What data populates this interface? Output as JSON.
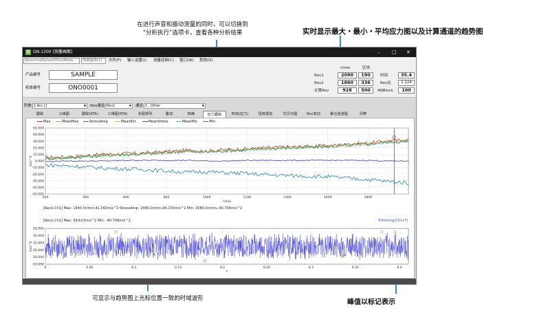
{
  "annotations": {
    "top_center": [
      "在进行声音和振动测量的同时，可以切换到",
      "“分析执行”选项卡，查看各种分析结果"
    ],
    "top_right": "实时显示最大・最小・平均应力图以及计算通道的趋势图",
    "bottom_center": "可显示与趋势图上光标位置一致的时域波形",
    "bottom_right": "峰值以标记表示"
  },
  "window": {
    "title": "GN-1200 [测量画面]",
    "logo": "G",
    "controls": [
      "–",
      "□",
      "✕"
    ]
  },
  "menubar": {
    "doc_tabs": [
      "AbnormalNoiseOfflineMode",
      "导航指导(1)"
    ],
    "items": [
      "文件(F)",
      "输入设置(I)",
      "测量控制(C)",
      "窗口(W)",
      "其他(O)"
    ]
  },
  "info": {
    "product_label": "产品编号",
    "product_value": "SAMPLE",
    "machine_label": "机体编号",
    "machine_value": "ONO0001",
    "unit_rmin": "r/min",
    "section_label": "区块",
    "rev1_label": "Rev1",
    "rev1_value": "2090",
    "rev1_section": "190",
    "rev2_label": "Rev2",
    "rev2_value": "1860",
    "rev2_section": "336",
    "calc_label": "计算Rev",
    "calc_value": "928",
    "calc_section": "500",
    "time_label": "时间",
    "time_value": "35.4",
    "revratio_label": "Rev比",
    "revratio_value": "1.124",
    "anblock_label": "ANBlock",
    "anblock_value": "100"
  },
  "selectors": {
    "stage_label": "阶数",
    "stage_value": "1 Acc.[]",
    "rev_label": "Rev通道",
    "rev_value": "Rev1",
    "channel_label": "通道",
    "channel_value": "1 , Other"
  },
  "tabs": [
    "跟踪",
    "三维图",
    "跟踪(RTA)",
    "三维图(RTA)",
    "多图排列",
    "叠加",
    "四维",
    "应力跟踪",
    "时域(应力)",
    "扭转振动",
    "坎贝尔图",
    "Rev变动",
    "聚合信道程",
    "列表"
  ],
  "active_tab": "应力跟踪",
  "legend": [
    {
      "label": "Max",
      "color": "#d22a2a"
    },
    {
      "label": "MeanMax",
      "color": "#f08a4b"
    },
    {
      "label": "StressAmp",
      "color": "#2b7d2b"
    },
    {
      "label": "MeanExt",
      "color": "#d7c51e"
    },
    {
      "label": "MeanStress",
      "color": "#3a3acf"
    },
    {
      "label": "MeanMin",
      "color": "#3fc0c0"
    },
    {
      "label": "Min",
      "color": "#1a8a9a"
    }
  ],
  "chart_data": [
    {
      "type": "line",
      "ylabel": "m/s^2",
      "xlabel": "r/min",
      "xlim": [
        200,
        2000
      ],
      "ylim": [
        -50,
        50
      ],
      "x_ticks": [
        "200",
        "400",
        "600",
        "800",
        "1000",
        "1200",
        "1400",
        "1600",
        "1800"
      ],
      "y_ticks": [
        "50.000",
        "40.000",
        "30.000",
        "20.000",
        "10.000",
        "0.000",
        "-10.000",
        "-20.000",
        "-30.000",
        "-40.000",
        "-50.000"
      ],
      "x": [
        200,
        300,
        400,
        500,
        600,
        700,
        800,
        900,
        1000,
        1100,
        1200,
        1300,
        1400,
        1500,
        1600,
        1700,
        1800,
        1900,
        2000
      ],
      "series": [
        {
          "name": "Max",
          "values": [
            5,
            6,
            8,
            10,
            11,
            12,
            14,
            16,
            15,
            17,
            18,
            20,
            21,
            22,
            23,
            25,
            27,
            30,
            32
          ]
        },
        {
          "name": "StressAmp",
          "values": [
            4,
            5,
            7,
            9,
            10,
            11,
            13,
            15,
            14,
            16,
            17,
            19,
            20,
            21,
            22,
            24,
            26,
            29,
            30
          ]
        },
        {
          "name": "MeanStress",
          "values": [
            -1,
            0,
            0,
            0,
            1,
            1,
            1,
            1,
            0,
            0,
            1,
            1,
            1,
            1,
            1,
            1,
            1,
            0,
            0
          ]
        },
        {
          "name": "Min",
          "values": [
            -6,
            -7,
            -9,
            -11,
            -12,
            -13,
            -15,
            -17,
            -16,
            -18,
            -19,
            -21,
            -22,
            -23,
            -24,
            -26,
            -28,
            -31,
            -33
          ]
        }
      ],
      "cursor_x": 1930,
      "info_line": "[Rev1-Ch1] Max: 1940.0r/min,41.342m/s^2 StressAmp: 2080.0r/min,40.150m/s^2 Min: 2080.0r/min,-40.706m/s^2"
    },
    {
      "type": "line",
      "ylabel": "m/s^2",
      "xlabel": "s",
      "xlim": [
        0,
        0.41
      ],
      "ylim": [
        -50,
        50
      ],
      "x_ticks": [
        "0",
        "0.05",
        "0.1",
        "0.15",
        "0.2",
        "0.25",
        "0.3",
        "0.35",
        "0.4"
      ],
      "y_ticks": [
        "50.000",
        "40.000",
        "30.000",
        "20.000",
        "10.000",
        "0.000",
        "-10.000",
        "-20.000",
        "-30.000",
        "-40.000",
        "-50.000"
      ],
      "amplitude": 40,
      "info_line": "[Rev1-Ch1] Max: 39.613m/s^2 Min: -40.706m/s^2",
      "trimming": "Trimming(Ctrl+T)"
    }
  ]
}
